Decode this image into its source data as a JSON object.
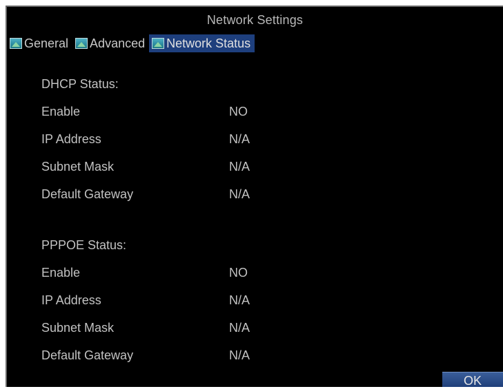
{
  "window": {
    "title": "Network Settings"
  },
  "tabs": [
    {
      "label": "General",
      "icon": "tab-icon",
      "active": false
    },
    {
      "label": "Advanced",
      "icon": "tab-icon",
      "active": false
    },
    {
      "label": "Network Status",
      "icon": "tab-icon",
      "active": true
    }
  ],
  "dhcp": {
    "heading": "DHCP Status:",
    "rows": [
      {
        "label": "Enable",
        "value": "NO"
      },
      {
        "label": "IP Address",
        "value": "N/A"
      },
      {
        "label": "Subnet Mask",
        "value": "N/A"
      },
      {
        "label": "Default Gateway",
        "value": "N/A"
      }
    ]
  },
  "pppoe": {
    "heading": "PPPOE Status:",
    "rows": [
      {
        "label": "Enable",
        "value": "NO"
      },
      {
        "label": "IP Address",
        "value": "N/A"
      },
      {
        "label": "Subnet Mask",
        "value": "N/A"
      },
      {
        "label": "Default Gateway",
        "value": "N/A"
      }
    ]
  },
  "buttons": {
    "ok_label": "OK"
  },
  "colors": {
    "background": "#000000",
    "active_tab": "#1e3f7d",
    "text": "#c2c2c2"
  }
}
